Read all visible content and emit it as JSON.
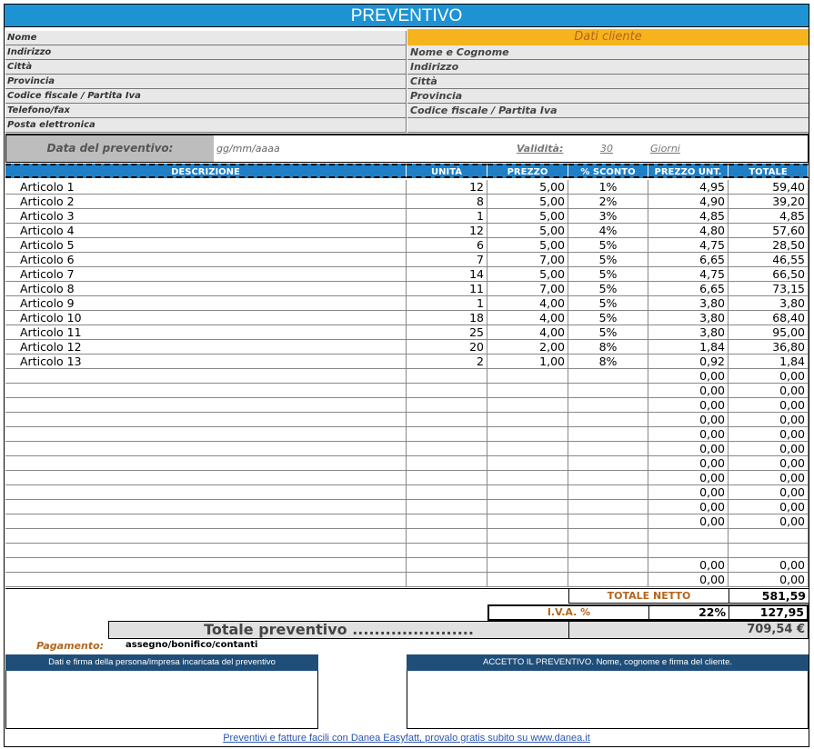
{
  "title": "PREVENTIVO",
  "company_fields": [
    "Nome",
    "Indirizzo",
    "Città",
    "Provincia",
    "Codice fiscale / Partita Iva",
    "Telefono/fax",
    "Posta elettronica"
  ],
  "client": {
    "header": "Dati cliente",
    "fields": [
      "Nome e Cognome",
      "Indirizzo",
      "Città",
      "Provincia",
      "Codice fiscale / Partita Iva"
    ]
  },
  "quote_date": {
    "label": "Data del preventivo:",
    "value": "gg/mm/aaaa"
  },
  "validity": {
    "label": "Validità:",
    "value": "30",
    "unit": "Giorni"
  },
  "columns": [
    "DESCRIZIONE",
    "UNITÀ",
    "PREZZO",
    "% SCONTO",
    "PREZZO UNT.",
    "TOTALE"
  ],
  "rows": [
    [
      "Articolo 1",
      "12",
      "5,00",
      "1%",
      "4,95",
      "59,40"
    ],
    [
      "Articolo 2",
      "8",
      "5,00",
      "2%",
      "4,90",
      "39,20"
    ],
    [
      "Articolo 3",
      "1",
      "5,00",
      "3%",
      "4,85",
      "4,85"
    ],
    [
      "Articolo 4",
      "12",
      "5,00",
      "4%",
      "4,80",
      "57,60"
    ],
    [
      "Articolo 5",
      "6",
      "5,00",
      "5%",
      "4,75",
      "28,50"
    ],
    [
      "Articolo 6",
      "7",
      "7,00",
      "5%",
      "6,65",
      "46,55"
    ],
    [
      "Articolo 7",
      "14",
      "5,00",
      "5%",
      "4,75",
      "66,50"
    ],
    [
      "Articolo 8",
      "11",
      "7,00",
      "5%",
      "6,65",
      "73,15"
    ],
    [
      "Articolo 9",
      "1",
      "4,00",
      "5%",
      "3,80",
      "3,80"
    ],
    [
      "Articolo 10",
      "18",
      "4,00",
      "5%",
      "3,80",
      "68,40"
    ],
    [
      "Articolo 11",
      "25",
      "4,00",
      "5%",
      "3,80",
      "95,00"
    ],
    [
      "Articolo 12",
      "20",
      "2,00",
      "8%",
      "1,84",
      "36,80"
    ],
    [
      "Articolo 13",
      "2",
      "1,00",
      "8%",
      "0,92",
      "1,84"
    ],
    [
      "",
      "",
      "",
      "",
      "0,00",
      "0,00"
    ],
    [
      "",
      "",
      "",
      "",
      "0,00",
      "0,00"
    ],
    [
      "",
      "",
      "",
      "",
      "0,00",
      "0,00"
    ],
    [
      "",
      "",
      "",
      "",
      "0,00",
      "0,00"
    ],
    [
      "",
      "",
      "",
      "",
      "0,00",
      "0,00"
    ],
    [
      "",
      "",
      "",
      "",
      "0,00",
      "0,00"
    ],
    [
      "",
      "",
      "",
      "",
      "0,00",
      "0,00"
    ],
    [
      "",
      "",
      "",
      "",
      "0,00",
      "0,00"
    ],
    [
      "",
      "",
      "",
      "",
      "0,00",
      "0,00"
    ],
    [
      "",
      "",
      "",
      "",
      "0,00",
      "0,00"
    ],
    [
      "",
      "",
      "",
      "",
      "0,00",
      "0,00"
    ],
    [
      "",
      "",
      "",
      "",
      "",
      ""
    ],
    [
      "",
      "",
      "",
      "",
      "",
      ""
    ],
    [
      "",
      "",
      "",
      "",
      "0,00",
      "0,00"
    ],
    [
      "",
      "",
      "",
      "",
      "0,00",
      "0,00"
    ]
  ],
  "totals": {
    "net_label": "TOTALE NETTO",
    "net_value": "581,59",
    "vat_label": "I.V.A. %",
    "vat_rate": "22%",
    "vat_value": "127,95",
    "grand_label": "Totale preventivo ......................",
    "grand_value": "709,54 €"
  },
  "payment": {
    "label": "Pagamento:",
    "value": "assegno/bonifico/contanti"
  },
  "sign_left": "Dati e firma della persona/impresa incaricata del preventivo",
  "sign_right": "ACCETTO IL PREVENTIVO. Nome, cognome e firma del cliente.",
  "footer": "Preventivi e fatture facili con Danea Easyfatt, provalo gratis subito su www.danea.it",
  "colors": {
    "title_blue": "#1e93d4",
    "header_blue": "#1e7fc6",
    "client_orange": "#f5b31c",
    "sign_navy": "#1f4e79"
  }
}
